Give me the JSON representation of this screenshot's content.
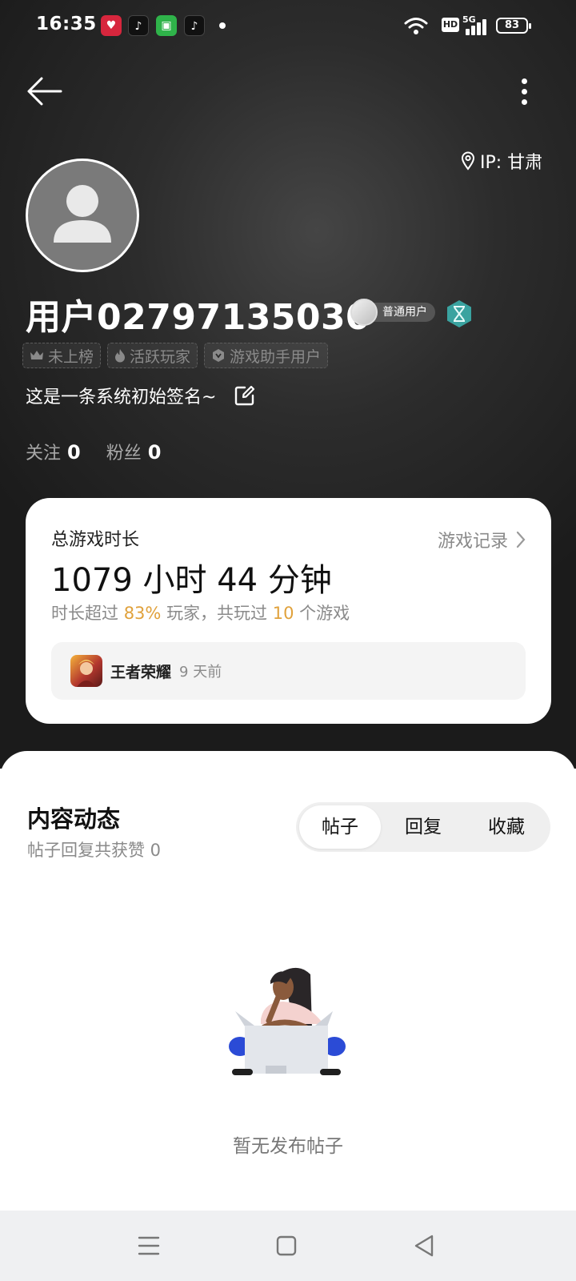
{
  "status_bar": {
    "time": "16:35",
    "network_hd": "HD",
    "network_gen": "5G",
    "battery": "83",
    "notification_icons": [
      "app-red-icon",
      "tiktok-icon",
      "shopping-green-icon",
      "tiktok-lite-icon"
    ]
  },
  "header": {
    "back_icon": "arrow-left-icon",
    "more_icon": "more-vertical-icon",
    "ip_label": "IP: 甘肃"
  },
  "profile": {
    "username": "用户02797135030",
    "level_label": "普通用户",
    "tags": [
      {
        "icon": "crown-icon",
        "label": "未上榜"
      },
      {
        "icon": "flame-icon",
        "label": "活跃玩家"
      },
      {
        "icon": "hexagon-icon",
        "label": "游戏助手用户"
      }
    ],
    "signature": "这是一条系统初始签名~",
    "following_label": "关注",
    "following_count": "0",
    "fans_label": "粉丝",
    "fans_count": "0"
  },
  "game_card": {
    "title": "总游戏时长",
    "record_link": "游戏记录",
    "total_time": "1079 小时 44 分钟",
    "stat_prefix": "时长超过",
    "stat_percent": "83%",
    "stat_middle": "玩家，共玩过",
    "stat_games": "10",
    "stat_suffix": "个游戏",
    "recent_game": "王者荣耀",
    "recent_time": "9 天前"
  },
  "content": {
    "title": "内容动态",
    "subtitle": "帖子回复共获赞 0",
    "tabs": [
      "帖子",
      "回复",
      "收藏"
    ],
    "active_tab": 0,
    "empty_text": "暂无发布帖子"
  },
  "colors": {
    "highlight": "#e0a13b",
    "hero_bg": "#2c2c2c",
    "hourglass": "#3aa3a0"
  }
}
